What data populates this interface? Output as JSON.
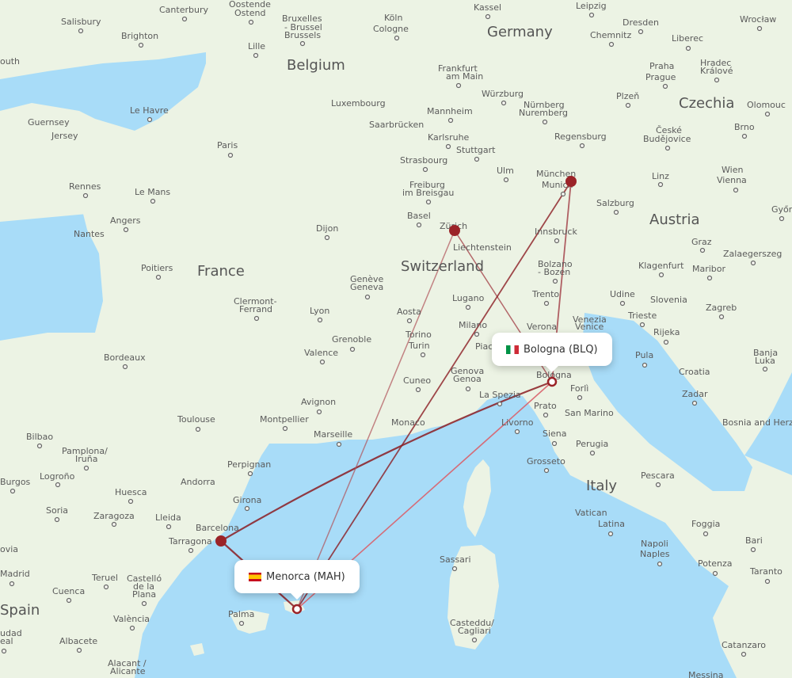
{
  "map": {
    "colors": {
      "water": "#a8dcf8",
      "land": "#ecf3e4",
      "border": "#8ccf8a",
      "route_dark": "#8b1c22",
      "route_light": "#d9606a",
      "hub_marker": "#9b2328"
    },
    "airports": {
      "origin": {
        "name": "Menorca (MAH)",
        "country_flag": "spain-flag"
      },
      "destination": {
        "name": "Bologna (BLQ)",
        "country_flag": "italy-flag"
      }
    },
    "hubs": [
      "Barcelona",
      "Zürich",
      "München"
    ],
    "routes": [
      {
        "from": "Menorca",
        "via": "Barcelona",
        "to": "Bologna"
      },
      {
        "from": "Menorca",
        "via": "Zürich",
        "to": "Bologna"
      },
      {
        "from": "Menorca",
        "via": "München",
        "to": "Bologna"
      },
      {
        "from": "Menorca",
        "to": "Bologna",
        "direct": true
      }
    ],
    "country_labels": [
      "Germany",
      "Belgium",
      "France",
      "Switzerland",
      "Liechtenstein",
      "Czechia",
      "Austria",
      "Slovenia",
      "Croatia",
      "Italy",
      "Spain",
      "Andorra",
      "Monaco",
      "San Marino",
      "Vatican",
      "Bosnia and Herzegovina",
      "Guernsey",
      "Jersey",
      "Luxembourg"
    ],
    "city_labels": [
      "Salisbury",
      "Canterbury",
      "Brighton",
      "Oostende Ostend",
      "Bruxelles - Brussel Brussels",
      "Lille",
      "Köln Cologne",
      "Kassel",
      "Leipzig",
      "Dresden",
      "Chemnitz",
      "Wrocław",
      "Liberec",
      "Praha Prague",
      "Hradec Králové",
      "Frankfurt am Main",
      "Würzburg",
      "Nürnberg Nuremberg",
      "Mannheim",
      "Saarbrücken",
      "Karlsruhe",
      "Stuttgart",
      "Strasbourg",
      "Plzeň",
      "Olomouc",
      "Brno",
      "České Budějovice",
      "Regensburg",
      "Ulm",
      "München Munich",
      "Freiburg im Breisgau",
      "Basel",
      "Zürich",
      "Salzburg",
      "Linz",
      "Wien Vienna",
      "Győr",
      "Innsbruck",
      "Graz",
      "Zalaegerszeg",
      "Klagenfurt",
      "Maribor",
      "Bolzano - Bozen",
      "Trento",
      "Udine",
      "Trieste",
      "Zagreb",
      "Rijeka",
      "Venezia Venice",
      "Verona",
      "Pula",
      "Banja Luka",
      "Zadar",
      "Le Havre",
      "Paris",
      "Rennes",
      "Le Mans",
      "Angers",
      "Nantes",
      "Dijon",
      "Poitiers",
      "Clermont-Ferrand",
      "Lyon",
      "Genève Geneva",
      "Grenoble",
      "Valence",
      "Bordeaux",
      "Aosta",
      "Torino Turin",
      "Lugano",
      "Milano",
      "Piacenza",
      "Genova Genoa",
      "Cuneo",
      "La Spezia",
      "Bologna",
      "Forlì",
      "Prato",
      "Livorno",
      "Siena",
      "Perugia",
      "Grosseto",
      "Pescara",
      "Latina",
      "Napoli Naples",
      "Foggia",
      "Bari",
      "Potenza",
      "Taranto",
      "Catanzaro",
      "Messina",
      "Avignon",
      "Toulouse",
      "Montpellier",
      "Marseille",
      "Bilbao",
      "Pamplona/ Iruña",
      "Logroño",
      "Burgos",
      "Perpignan",
      "Girona",
      "Huesca",
      "Soria",
      "Zaragoza",
      "Lleida",
      "Barcelona",
      "Tarragona",
      "Madrid",
      "Teruel",
      "Castelló de la Plana",
      "Cuenca",
      "València",
      "Albacete",
      "Alacant / Alicante",
      "Ciudad Real",
      "Palma",
      "Sassari",
      "Casteddu/ Cagliari"
    ]
  }
}
